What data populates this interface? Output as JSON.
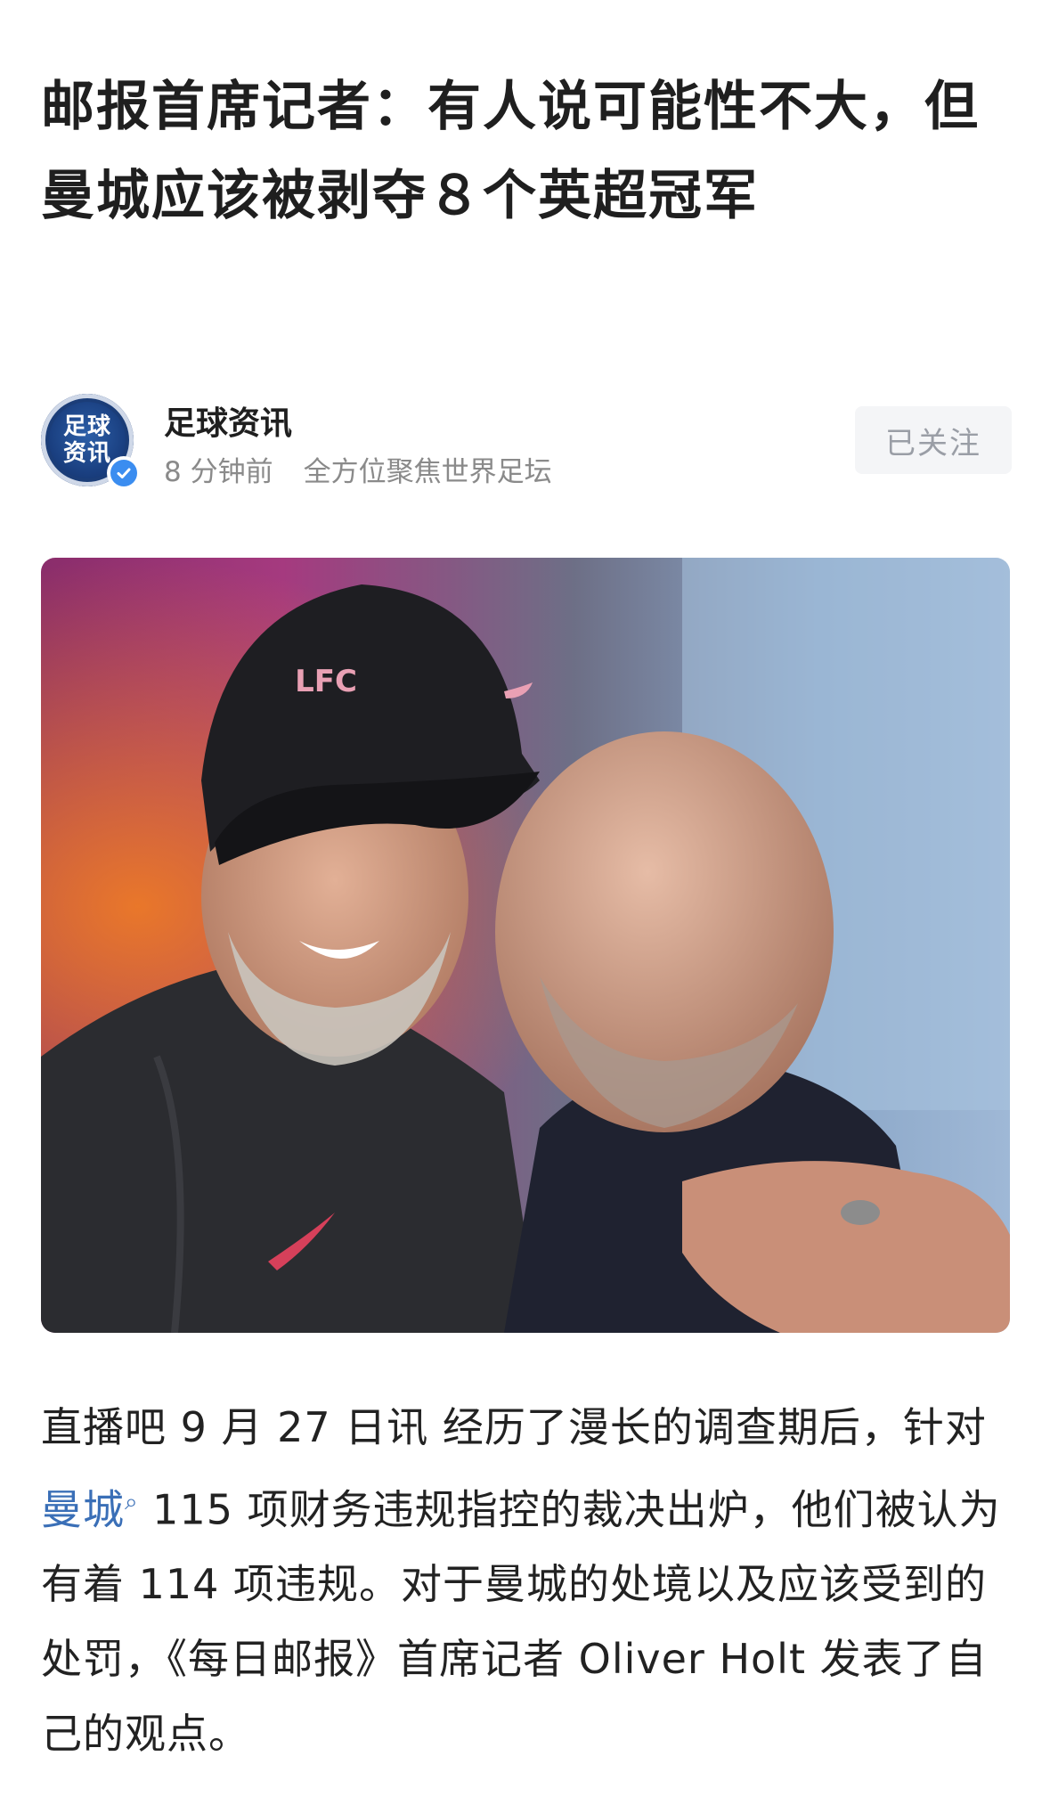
{
  "article": {
    "title": "邮报首席记者：有人说可能性不大，但曼城应该被剥夺８个英超冠军",
    "author": {
      "avatar_text": [
        "足球",
        "资讯"
      ],
      "name": "足球资讯",
      "time": "8 分钟前",
      "tagline": "全方位聚焦世界足坛",
      "verified_icon": "verified-check-icon",
      "follow_label": "已关注"
    },
    "image": {
      "cap_badge": "LFC"
    },
    "body": {
      "part1": "直播吧 9 月 27 日讯 经历了漫长的调查期后，针对",
      "link_text": "曼城",
      "link_icon": "search-icon",
      "part2": " 115 项财务违规指控的裁决出炉，他们被认为有着 114 项违规。对于曼城的处境以及应该受到的处罚，《每日邮报》首席记者 Oliver Holt 发表了自己的观点。"
    }
  },
  "colors": {
    "link": "#3a6fb7",
    "verified": "#3b8df0",
    "follow_bg": "#f4f5f7"
  }
}
